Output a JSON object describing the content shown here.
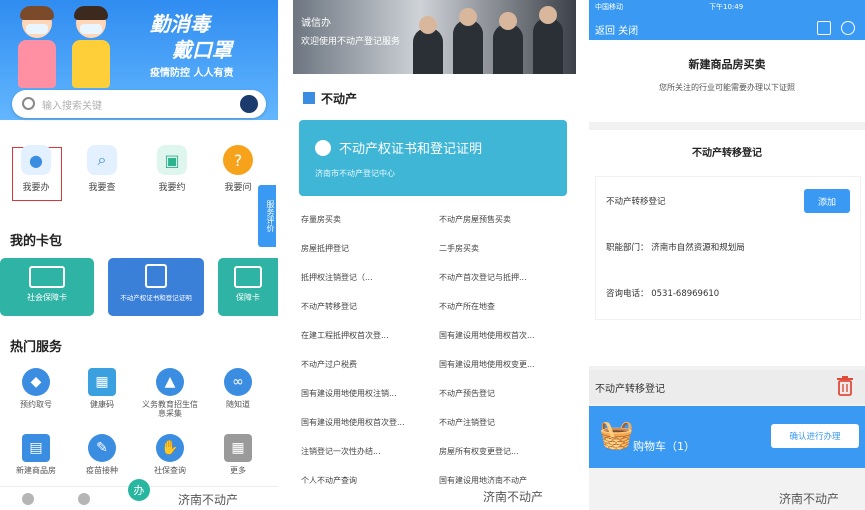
{
  "panel1": {
    "slogan1": "勤消毒",
    "slogan2": "戴口罩",
    "slogan3": "疫情防控  人人有责",
    "search_placeholder": "输入搜索关键",
    "quick_actions": [
      {
        "label": "我要办",
        "icon": "user-icon"
      },
      {
        "label": "我要查",
        "icon": "search-icon"
      },
      {
        "label": "我要约",
        "icon": "calendar-icon"
      },
      {
        "label": "我要问",
        "icon": "question-icon"
      }
    ],
    "side_tab": "服务评价",
    "section_cards": "我的卡包",
    "cards": [
      {
        "label": "社会保障卡",
        "color": "#2eb3a4"
      },
      {
        "label": "不动产权证书和登记证明",
        "color": "#3a7fd8"
      },
      {
        "label": "保障卡",
        "color": "#2eb3a4"
      }
    ],
    "section_hot": "热门服务",
    "services": [
      {
        "label": "预约取号",
        "icon": "diamond-icon",
        "color": "#3a8de0"
      },
      {
        "label": "健康码",
        "icon": "qr-icon",
        "color": "#3aa0e0"
      },
      {
        "label": "义务教育招生信息采集",
        "icon": "graduate-icon",
        "color": "#3a8de0"
      },
      {
        "label": "随知道",
        "icon": "link-icon",
        "color": "#3a8de0"
      },
      {
        "label": "新建商品房",
        "icon": "document-icon",
        "color": "#3a8de0"
      },
      {
        "label": "疫苗接种",
        "icon": "syringe-icon",
        "color": "#3a8de0"
      },
      {
        "label": "社保查询",
        "icon": "hand-icon",
        "color": "#3a8de0"
      },
      {
        "label": "更多",
        "icon": "grid-icon",
        "color": "#9a9a9a"
      }
    ],
    "tabbar_center": "办",
    "watermark": "济南不动产"
  },
  "panel2": {
    "photo_caption1": "诚信办",
    "photo_caption2": "欢迎使用不动产登记服务",
    "section_title": "不动产",
    "card_title": "不动产权证书和登记证明",
    "card_subtitle": "济南市不动产登记中心",
    "items": [
      "存量房买卖",
      "不动产房屋预售买卖",
      "房屋抵押登记",
      "二手房买卖",
      "抵押权注销登记（...",
      "不动产首次登记与抵押...",
      "不动产转移登记",
      "不动产所在地查",
      "在建工程抵押权首次登...",
      "国有建设用地使用权首次...",
      "不动产过户税费",
      "国有建设用地使用权变更...",
      "国有建设用地使用权注销...",
      "不动产预告登记",
      "国有建设用地使用权首次登...",
      "不动产注销登记",
      "注销登记一次性办结...",
      "房屋所有权变更登记...",
      "个人不动产查询",
      "国有建设用地济南不动产"
    ],
    "watermark": "济南不动产"
  },
  "panel3": {
    "status_left": "中国移动",
    "status_time": "下午10:49",
    "back_label": "返回  关闭",
    "sheet_title": "新建商品房买卖",
    "sheet_note": "您所关注的行业可能需要办理以下证照",
    "section_title": "不动产转移登记",
    "row_item": "不动产转移登记",
    "add_label": "添加",
    "dept_label": "职能部门：",
    "dept_value": "济南市自然资源和规划局",
    "phone_label": "咨询电话：",
    "phone_value": "0531-68969610",
    "cart_line": "不动产转移登记",
    "cart_label": "购物车（1）",
    "confirm_label": "确认进行办理",
    "watermark": "济南不动产",
    "accent_color": "#3a9af3"
  }
}
